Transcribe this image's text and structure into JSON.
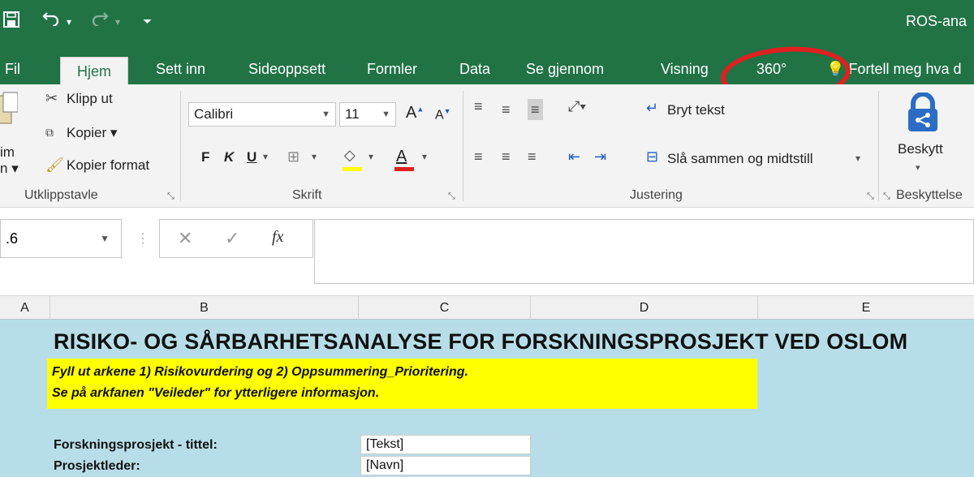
{
  "app": {
    "title": "ROS-ana",
    "brand_color": "#217346",
    "highlight_color": "#e02020"
  },
  "quick_access": [
    {
      "icon": "save-icon",
      "glyph": "🖫"
    },
    {
      "icon": "undo-icon",
      "glyph": "↶"
    },
    {
      "icon": "redo-icon",
      "glyph": "↷"
    },
    {
      "icon": "customize-icon",
      "glyph": "▾"
    }
  ],
  "tabs": [
    "Fil",
    "Hjem",
    "Sett inn",
    "Sideoppsett",
    "Formler",
    "Data",
    "Se gjennom",
    "Visning",
    "360°",
    "Fortell meg hva d"
  ],
  "active_tab": "Hjem",
  "ribbon": {
    "clipboard": {
      "paste_partial_1": "im",
      "paste_partial_2": "n",
      "cut": "Klipp ut",
      "copy": "Kopier",
      "format_painter": "Kopier format",
      "label": "Utklippstavle"
    },
    "font": {
      "name": "Calibri",
      "size": "11",
      "bold": "F",
      "italic": "K",
      "underline": "U",
      "label": "Skrift",
      "highlight_color": "#ffff00",
      "font_color": "#e02020"
    },
    "alignment": {
      "wrap_text": "Bryt tekst",
      "merge_center": "Slå sammen og midtstill",
      "label": "Justering"
    },
    "protection": {
      "protect": "Beskytt",
      "label": "Beskyttelse"
    }
  },
  "formula_bar": {
    "name_box": ".6",
    "fx": "fx",
    "formula": ""
  },
  "columns": [
    "A",
    "B",
    "C",
    "D",
    "E"
  ],
  "sheet": {
    "heading": "RISIKO- OG SÅRBARHETSANALYSE FOR FORSKNINGSPROSJEKT VED OSLOM",
    "note_line_1": "Fyll ut arkene 1) Risikovurdering og 2) Oppsummering_Prioritering.",
    "note_line_2": "Se på arkfanen \"Veileder\" for ytterligere informasjon.",
    "fields": [
      {
        "label": "Forskningsprosjekt - tittel:",
        "value": "[Tekst]"
      },
      {
        "label": "Prosjektleder:",
        "value": "[Navn]"
      }
    ],
    "background": "#b7dee8",
    "note_background": "#ffff00"
  }
}
